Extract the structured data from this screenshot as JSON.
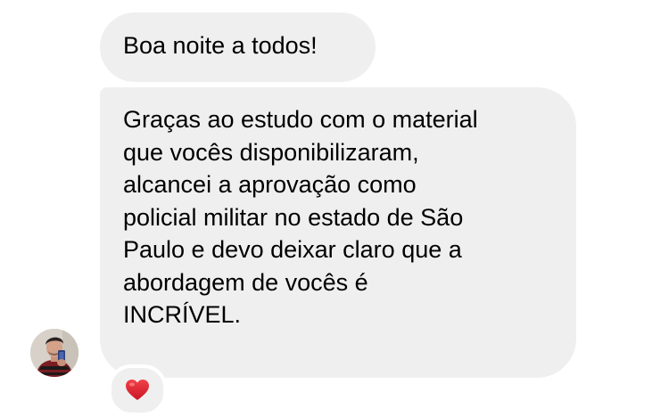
{
  "conversation": {
    "messages": [
      {
        "lines": [
          "Boa noite a todos!"
        ]
      },
      {
        "lines": [
          "Graças ao estudo com o material",
          "que vocês disponibilizaram,",
          "alcancei a aprovação como",
          "policial militar no estado de São",
          "Paulo e devo deixar claro que a",
          "abordagem de vocês é",
          "INCRÍVEL."
        ]
      }
    ],
    "sender_avatar": {
      "icon": "user-avatar-photo"
    },
    "reaction": {
      "icon": "red-heart-icon",
      "color": "#e0252f"
    }
  },
  "colors": {
    "bubble_background": "#efefef",
    "text": "#000000",
    "page_background": "#ffffff"
  }
}
